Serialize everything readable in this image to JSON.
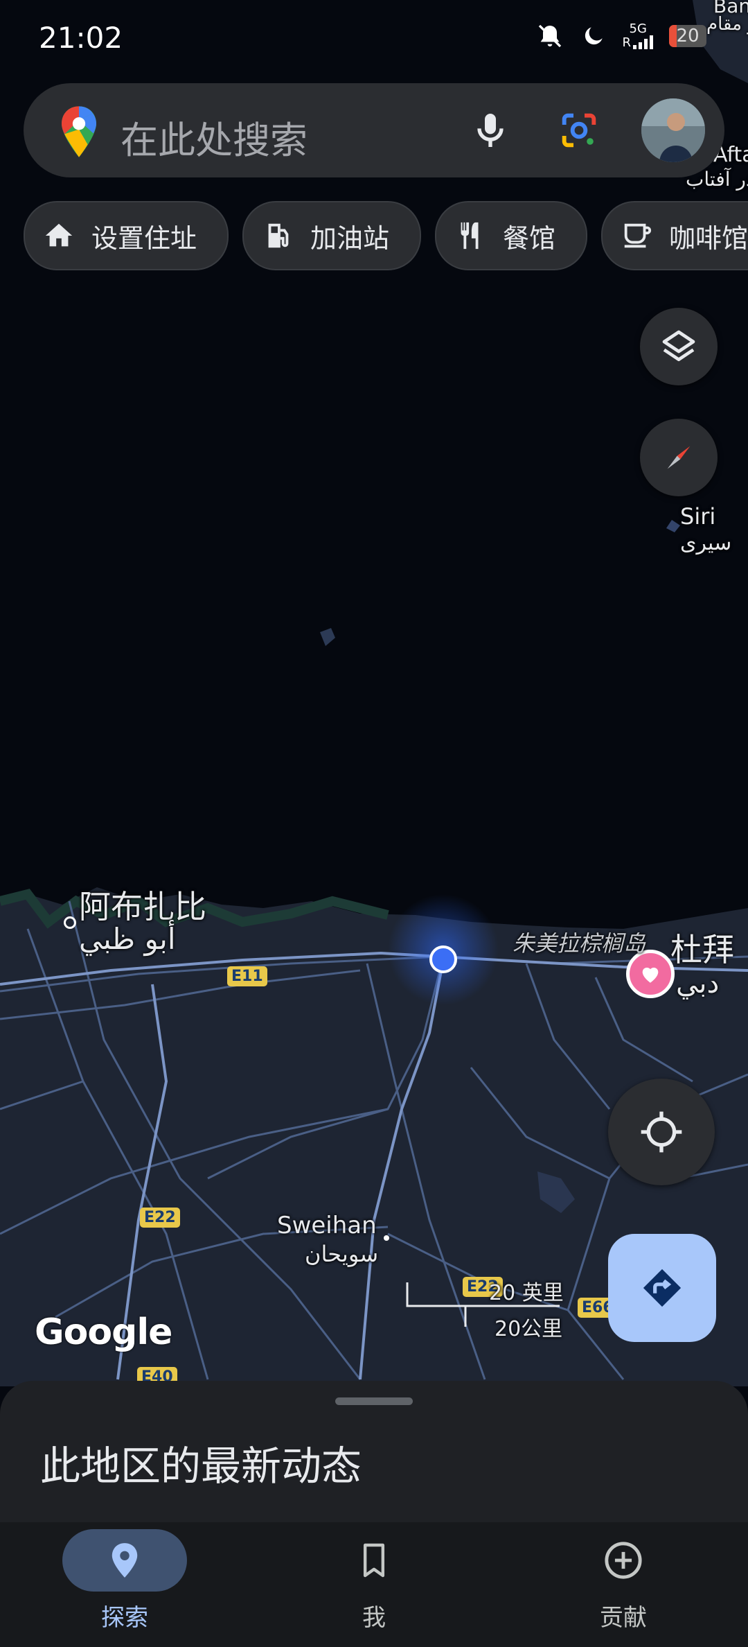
{
  "status_bar": {
    "time": "21:02",
    "network_type": "5G",
    "network_sub": "R",
    "battery_level": "20"
  },
  "search": {
    "placeholder": "在此处搜索"
  },
  "chips": [
    {
      "label": "设置住址",
      "icon": "home-icon"
    },
    {
      "label": "加油站",
      "icon": "gas-station-icon"
    },
    {
      "label": "餐馆",
      "icon": "restaurant-icon"
    },
    {
      "label": "咖啡馆",
      "icon": "coffee-icon"
    }
  ],
  "map": {
    "places": {
      "abu_dhabi_zh": "阿布扎比",
      "abu_dhabi_ar": "أبو ظبي",
      "dubai_zh": "杜拜",
      "dubai_ar": "دبي",
      "palm_jumeirah": "朱美拉棕榈岛",
      "sweihan_en": "Sweihan",
      "sweihan_ar": "سويحان",
      "siri_en": "Siri",
      "siri_ar": "سیری",
      "aftab_en": "Afta",
      "aftab_ar": "در آفتاب",
      "top_en": "Ban",
      "top_ar": "ر مقام"
    },
    "road_shields": [
      "E11",
      "E22",
      "E22",
      "E66",
      "E40"
    ],
    "scale_imperial": "20 英里",
    "scale_metric": "20公里",
    "attribution": "Google"
  },
  "bottom_sheet": {
    "title": "此地区的最新动态"
  },
  "bottom_nav": [
    {
      "label": "探索",
      "icon": "location-pin-icon",
      "active": true
    },
    {
      "label": "我",
      "icon": "bookmark-icon",
      "active": false
    },
    {
      "label": "贡献",
      "icon": "add-circle-icon",
      "active": false
    }
  ],
  "colors": {
    "accent": "#a8c7fa",
    "surface": "#2b2d31",
    "location_dot": "#3b6ef5",
    "favorite_pin": "#f26ba0"
  }
}
